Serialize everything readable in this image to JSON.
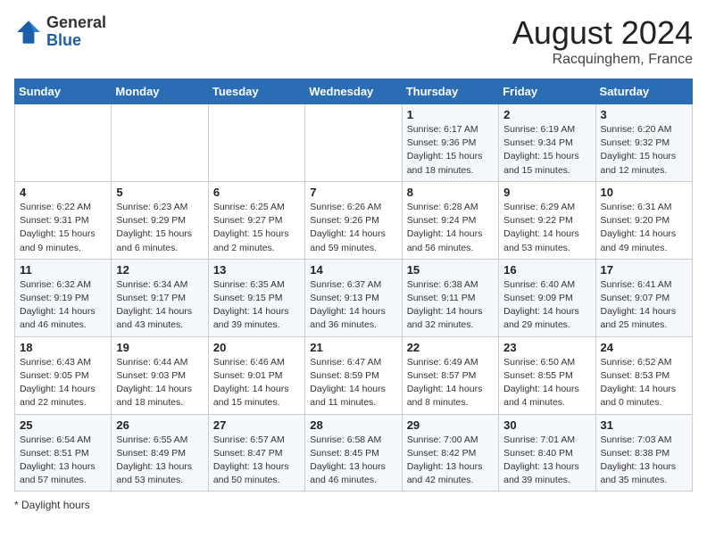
{
  "header": {
    "logo_general": "General",
    "logo_blue": "Blue",
    "month_year": "August 2024",
    "location": "Racquinghem, France"
  },
  "weekdays": [
    "Sunday",
    "Monday",
    "Tuesday",
    "Wednesday",
    "Thursday",
    "Friday",
    "Saturday"
  ],
  "weeks": [
    [
      {
        "day": "",
        "detail": ""
      },
      {
        "day": "",
        "detail": ""
      },
      {
        "day": "",
        "detail": ""
      },
      {
        "day": "",
        "detail": ""
      },
      {
        "day": "1",
        "detail": "Sunrise: 6:17 AM\nSunset: 9:36 PM\nDaylight: 15 hours\nand 18 minutes."
      },
      {
        "day": "2",
        "detail": "Sunrise: 6:19 AM\nSunset: 9:34 PM\nDaylight: 15 hours\nand 15 minutes."
      },
      {
        "day": "3",
        "detail": "Sunrise: 6:20 AM\nSunset: 9:32 PM\nDaylight: 15 hours\nand 12 minutes."
      }
    ],
    [
      {
        "day": "4",
        "detail": "Sunrise: 6:22 AM\nSunset: 9:31 PM\nDaylight: 15 hours\nand 9 minutes."
      },
      {
        "day": "5",
        "detail": "Sunrise: 6:23 AM\nSunset: 9:29 PM\nDaylight: 15 hours\nand 6 minutes."
      },
      {
        "day": "6",
        "detail": "Sunrise: 6:25 AM\nSunset: 9:27 PM\nDaylight: 15 hours\nand 2 minutes."
      },
      {
        "day": "7",
        "detail": "Sunrise: 6:26 AM\nSunset: 9:26 PM\nDaylight: 14 hours\nand 59 minutes."
      },
      {
        "day": "8",
        "detail": "Sunrise: 6:28 AM\nSunset: 9:24 PM\nDaylight: 14 hours\nand 56 minutes."
      },
      {
        "day": "9",
        "detail": "Sunrise: 6:29 AM\nSunset: 9:22 PM\nDaylight: 14 hours\nand 53 minutes."
      },
      {
        "day": "10",
        "detail": "Sunrise: 6:31 AM\nSunset: 9:20 PM\nDaylight: 14 hours\nand 49 minutes."
      }
    ],
    [
      {
        "day": "11",
        "detail": "Sunrise: 6:32 AM\nSunset: 9:19 PM\nDaylight: 14 hours\nand 46 minutes."
      },
      {
        "day": "12",
        "detail": "Sunrise: 6:34 AM\nSunset: 9:17 PM\nDaylight: 14 hours\nand 43 minutes."
      },
      {
        "day": "13",
        "detail": "Sunrise: 6:35 AM\nSunset: 9:15 PM\nDaylight: 14 hours\nand 39 minutes."
      },
      {
        "day": "14",
        "detail": "Sunrise: 6:37 AM\nSunset: 9:13 PM\nDaylight: 14 hours\nand 36 minutes."
      },
      {
        "day": "15",
        "detail": "Sunrise: 6:38 AM\nSunset: 9:11 PM\nDaylight: 14 hours\nand 32 minutes."
      },
      {
        "day": "16",
        "detail": "Sunrise: 6:40 AM\nSunset: 9:09 PM\nDaylight: 14 hours\nand 29 minutes."
      },
      {
        "day": "17",
        "detail": "Sunrise: 6:41 AM\nSunset: 9:07 PM\nDaylight: 14 hours\nand 25 minutes."
      }
    ],
    [
      {
        "day": "18",
        "detail": "Sunrise: 6:43 AM\nSunset: 9:05 PM\nDaylight: 14 hours\nand 22 minutes."
      },
      {
        "day": "19",
        "detail": "Sunrise: 6:44 AM\nSunset: 9:03 PM\nDaylight: 14 hours\nand 18 minutes."
      },
      {
        "day": "20",
        "detail": "Sunrise: 6:46 AM\nSunset: 9:01 PM\nDaylight: 14 hours\nand 15 minutes."
      },
      {
        "day": "21",
        "detail": "Sunrise: 6:47 AM\nSunset: 8:59 PM\nDaylight: 14 hours\nand 11 minutes."
      },
      {
        "day": "22",
        "detail": "Sunrise: 6:49 AM\nSunset: 8:57 PM\nDaylight: 14 hours\nand 8 minutes."
      },
      {
        "day": "23",
        "detail": "Sunrise: 6:50 AM\nSunset: 8:55 PM\nDaylight: 14 hours\nand 4 minutes."
      },
      {
        "day": "24",
        "detail": "Sunrise: 6:52 AM\nSunset: 8:53 PM\nDaylight: 14 hours\nand 0 minutes."
      }
    ],
    [
      {
        "day": "25",
        "detail": "Sunrise: 6:54 AM\nSunset: 8:51 PM\nDaylight: 13 hours\nand 57 minutes."
      },
      {
        "day": "26",
        "detail": "Sunrise: 6:55 AM\nSunset: 8:49 PM\nDaylight: 13 hours\nand 53 minutes."
      },
      {
        "day": "27",
        "detail": "Sunrise: 6:57 AM\nSunset: 8:47 PM\nDaylight: 13 hours\nand 50 minutes."
      },
      {
        "day": "28",
        "detail": "Sunrise: 6:58 AM\nSunset: 8:45 PM\nDaylight: 13 hours\nand 46 minutes."
      },
      {
        "day": "29",
        "detail": "Sunrise: 7:00 AM\nSunset: 8:42 PM\nDaylight: 13 hours\nand 42 minutes."
      },
      {
        "day": "30",
        "detail": "Sunrise: 7:01 AM\nSunset: 8:40 PM\nDaylight: 13 hours\nand 39 minutes."
      },
      {
        "day": "31",
        "detail": "Sunrise: 7:03 AM\nSunset: 8:38 PM\nDaylight: 13 hours\nand 35 minutes."
      }
    ]
  ],
  "footer": "Daylight hours"
}
